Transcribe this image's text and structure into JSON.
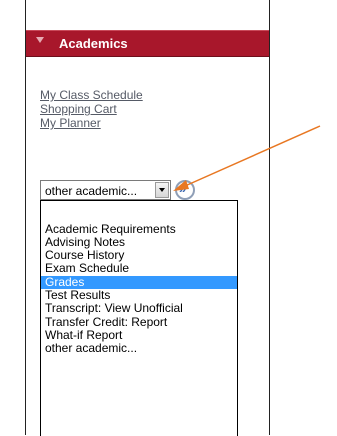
{
  "section": {
    "title": "Academics"
  },
  "links": [
    "My Class Schedule",
    "Shopping Cart",
    "My Planner"
  ],
  "select": {
    "value": "other academic...",
    "options": [
      "",
      "Academic Requirements",
      "Advising Notes",
      "Course History",
      "Exam Schedule",
      "Grades",
      "Test Results",
      "Transcript: View Unofficial",
      "Transfer Credit: Report",
      "What-if Report",
      "other academic..."
    ],
    "selected_option": "Grades"
  },
  "go_button": {
    "label": "»"
  },
  "colors": {
    "header_bg": "#a8172b",
    "link": "#555a66",
    "highlight": "#3399ff",
    "annotation_arrow": "#e87722"
  }
}
